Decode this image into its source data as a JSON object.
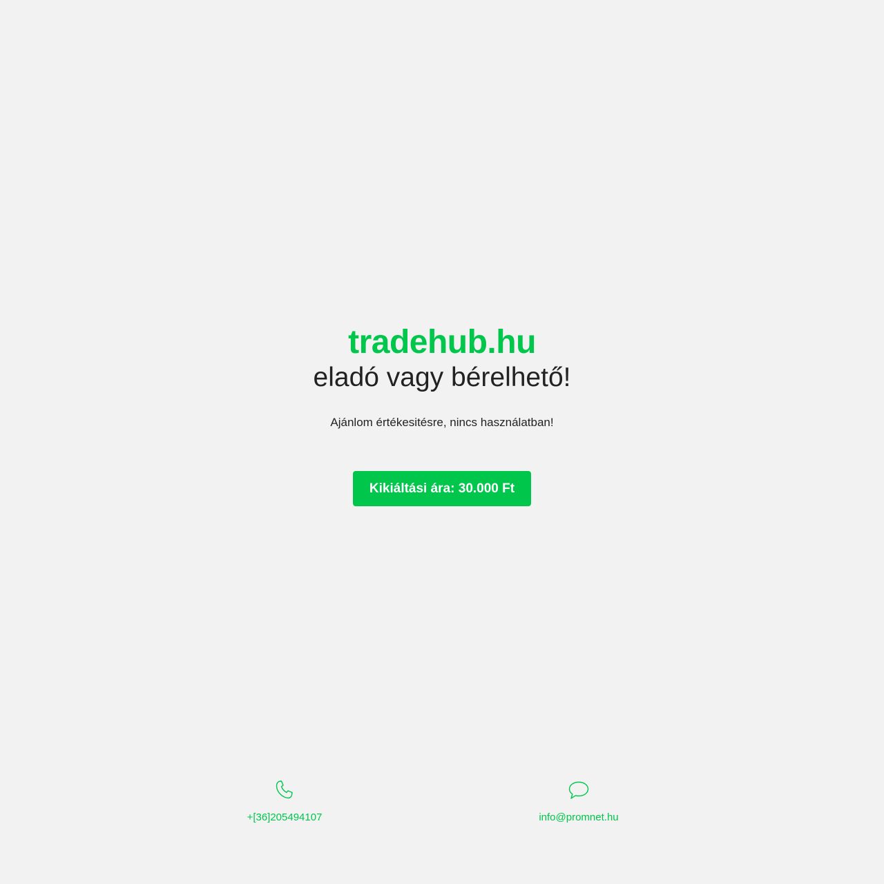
{
  "hero": {
    "domain": "tradehub.hu",
    "headline": "eladó vagy bérelhető!",
    "subtext": "Ajánlom értékesitésre, nincs használatban!"
  },
  "cta": {
    "label": "Kikiáltási ára: 30.000 Ft"
  },
  "contacts": {
    "phone": {
      "icon": "phone-icon",
      "label": "+[36]205494107"
    },
    "email": {
      "icon": "chat-bubble-icon",
      "label": "info@promnet.hu"
    }
  },
  "colors": {
    "accent": "#00c64c",
    "background": "#f2f2f2",
    "text": "#222222"
  }
}
